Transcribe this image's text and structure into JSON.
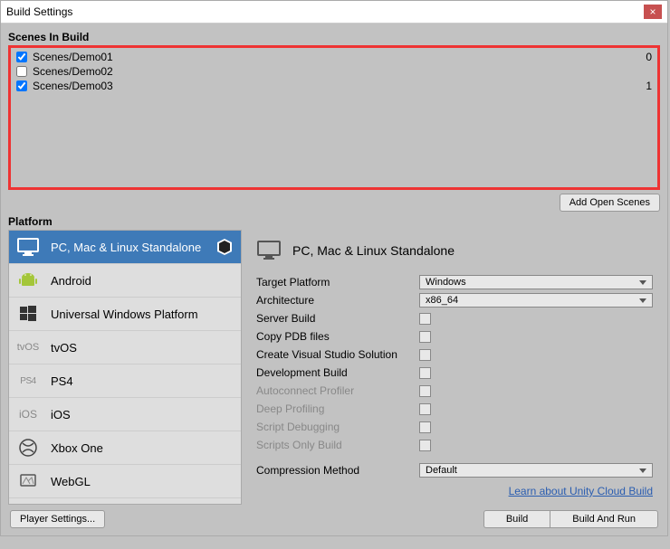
{
  "window": {
    "title": "Build Settings",
    "close": "×"
  },
  "scenes": {
    "label": "Scenes In Build",
    "items": [
      {
        "checked": true,
        "name": "Scenes/Demo01",
        "index": "0"
      },
      {
        "checked": false,
        "name": "Scenes/Demo02",
        "index": ""
      },
      {
        "checked": true,
        "name": "Scenes/Demo03",
        "index": "1"
      }
    ],
    "add_btn": "Add Open Scenes"
  },
  "platform": {
    "label": "Platform",
    "items": [
      {
        "id": "standalone",
        "label": "PC, Mac & Linux Standalone",
        "selected": true
      },
      {
        "id": "android",
        "label": "Android"
      },
      {
        "id": "uwp",
        "label": "Universal Windows Platform"
      },
      {
        "id": "tvos",
        "label": "tvOS"
      },
      {
        "id": "ps4",
        "label": "PS4"
      },
      {
        "id": "ios",
        "label": "iOS"
      },
      {
        "id": "xboxone",
        "label": "Xbox One"
      },
      {
        "id": "webgl",
        "label": "WebGL"
      }
    ]
  },
  "settings": {
    "header": "PC, Mac & Linux Standalone",
    "rows": {
      "target_platform": {
        "label": "Target Platform",
        "value": "Windows"
      },
      "architecture": {
        "label": "Architecture",
        "value": "x86_64"
      },
      "server_build": {
        "label": "Server Build"
      },
      "copy_pdb": {
        "label": "Copy PDB files"
      },
      "create_vs": {
        "label": "Create Visual Studio Solution"
      },
      "dev_build": {
        "label": "Development Build"
      },
      "autoconnect": {
        "label": "Autoconnect Profiler"
      },
      "deep_profiling": {
        "label": "Deep Profiling"
      },
      "script_debug": {
        "label": "Script Debugging"
      },
      "scripts_only": {
        "label": "Scripts Only Build"
      },
      "compression": {
        "label": "Compression Method",
        "value": "Default"
      }
    },
    "cloud_link": "Learn about Unity Cloud Build"
  },
  "bottom": {
    "player_settings": "Player Settings...",
    "build": "Build",
    "build_run": "Build And Run"
  }
}
